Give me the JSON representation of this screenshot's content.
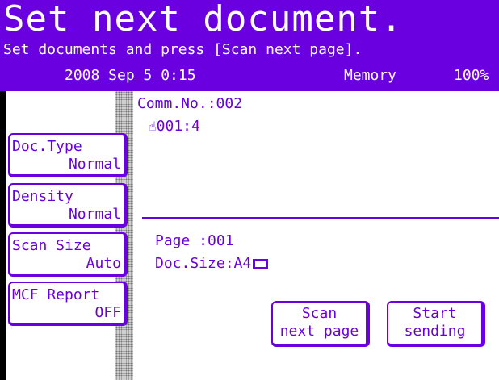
{
  "header": {
    "title": "Set next document.",
    "subtitle": "Set documents and press [Scan next page].",
    "date": "2008 Sep  5  0:15",
    "memory_label": "Memory",
    "memory_value": "100%"
  },
  "sidebar": {
    "items": [
      {
        "label": "Doc.Type",
        "value": "Normal"
      },
      {
        "label": "Density",
        "value": "Normal"
      },
      {
        "label": "Scan Size",
        "value": "Auto"
      },
      {
        "label": "MCF Report",
        "value": "OFF"
      }
    ]
  },
  "main": {
    "comm_no": "Comm.No.:002",
    "job_icon": "hand-icon",
    "job": "001:4",
    "page": "Page :001",
    "doc_size": "Doc.Size:A4",
    "paper_icon": "landscape-paper-icon"
  },
  "actions": {
    "scan_next_line1": "Scan",
    "scan_next_line2": "next page",
    "start_line1": "Start",
    "start_line2": "sending"
  },
  "colors": {
    "accent": "#6a00e0",
    "background": "#ffffff"
  }
}
